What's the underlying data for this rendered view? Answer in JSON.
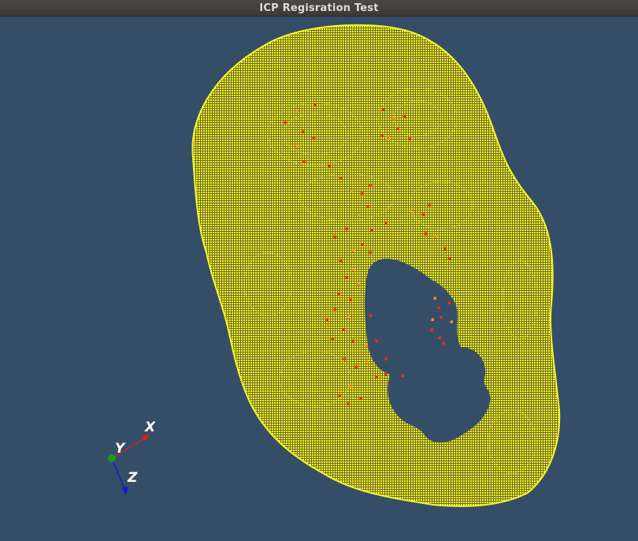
{
  "window": {
    "title": "ICP Regisration Test"
  },
  "viewer": {
    "background_color": "#354e68",
    "target_cloud_color": "#ffff00",
    "source_points_color": "#ff2a00",
    "source_points_secondary_color": "#ff8c1a"
  },
  "axes_widget": {
    "x_label": "X",
    "y_label": "Y",
    "z_label": "Z",
    "x_color": "#d42020",
    "y_color": "#1a9a1a",
    "z_color": "#1a1acc"
  }
}
